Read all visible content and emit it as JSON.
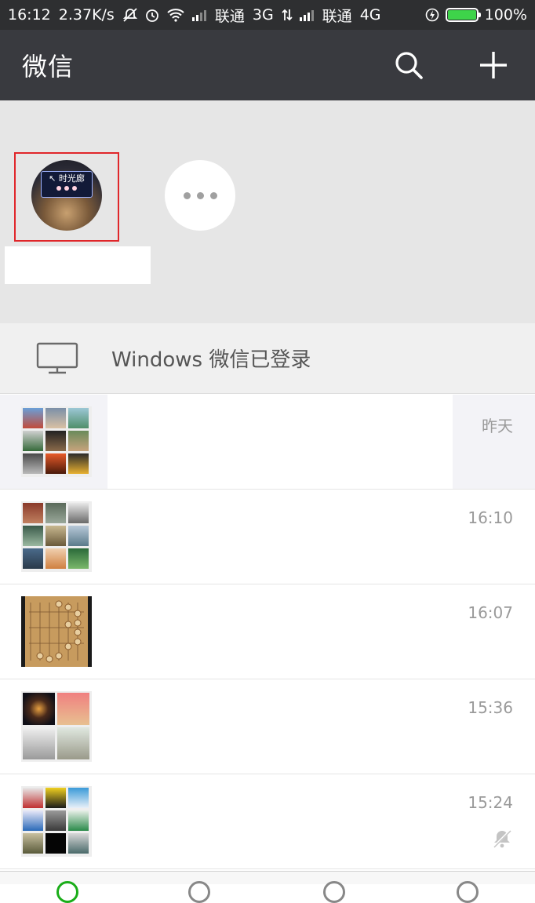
{
  "status_bar": {
    "time": "16:12",
    "speed": "2.37K/s",
    "carrier1": "联通",
    "net1": "3G",
    "carrier2": "联通",
    "net2": "4G",
    "battery": "100%",
    "battery_level": 1.0,
    "battery_color": "#3ed34a",
    "icons": [
      "do-not-disturb-icon",
      "alarm-icon",
      "wifi-icon",
      "signal-icon",
      "data-arrows-icon",
      "signal-icon",
      "charging-icon",
      "battery-icon"
    ]
  },
  "header": {
    "title": "微信",
    "search_icon": "search-icon",
    "add_icon": "plus-icon",
    "background": "#393a3f"
  },
  "mini_programs": {
    "items": [
      {
        "icon": "mini-program-avatar",
        "sign_text": "时光廊",
        "selected": true
      }
    ],
    "more_icon": "more-dots-icon",
    "selection_color": "#e0262a"
  },
  "login_banner": {
    "icon": "monitor-icon",
    "text": "Windows 微信已登录"
  },
  "chats": [
    {
      "time": "昨天",
      "pinned": true,
      "avatar": "group-avatar-grid",
      "muted": false
    },
    {
      "time": "16:10",
      "pinned": false,
      "avatar": "group-avatar-grid",
      "muted": false
    },
    {
      "time": "16:07",
      "pinned": false,
      "avatar": "chess-board-avatar",
      "muted": false
    },
    {
      "time": "15:36",
      "pinned": false,
      "avatar": "group-avatar-grid",
      "muted": false
    },
    {
      "time": "15:24",
      "pinned": false,
      "avatar": "group-avatar-grid",
      "muted": true
    }
  ]
}
